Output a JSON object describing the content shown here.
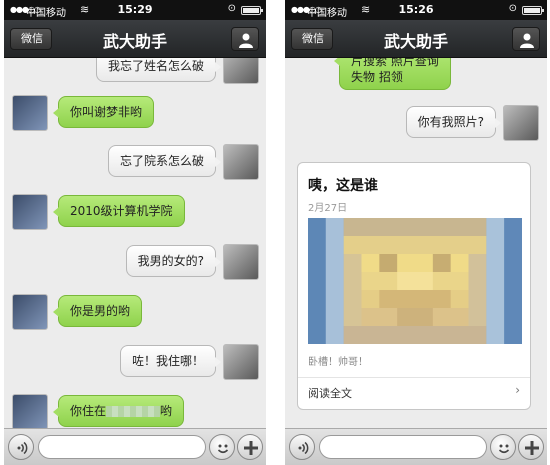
{
  "screens": [
    {
      "status": {
        "carrier": "中国移动",
        "time": "15:29"
      },
      "nav": {
        "back": "微信",
        "title": "武大助手"
      },
      "messages": [
        {
          "from": "me",
          "text": "我忘了姓名怎么破"
        },
        {
          "from": "bot",
          "text": "你叫谢梦非哟"
        },
        {
          "from": "me",
          "text": "忘了院系怎么破"
        },
        {
          "from": "bot",
          "text": "2010级计算机学院"
        },
        {
          "from": "me",
          "text": "我男的女的?"
        },
        {
          "from": "bot",
          "text": "你是男的哟"
        },
        {
          "from": "me",
          "text": "咗！我住哪！"
        },
        {
          "from": "bot",
          "text_before": "你住在",
          "text_after": "哟"
        }
      ]
    },
    {
      "status": {
        "carrier": "中国移动",
        "time": "15:26"
      },
      "nav": {
        "back": "微信",
        "title": "武大助手"
      },
      "partial_bot_line1": "片搜索  照片查询",
      "partial_bot_line2": "失物  招领",
      "me_message": "你有我照片?",
      "card": {
        "title": "咦，这是谁",
        "date": "2月27日",
        "summary": "卧槽！帅哥！",
        "read_more": "阅读全文"
      }
    }
  ],
  "icons": {
    "profile": "person-icon",
    "voice": "voice-icon",
    "emoji": "emoji-icon",
    "plus": "plus-icon",
    "chevron": "chevron-right-icon"
  },
  "colors": {
    "bubble_green": "#9ad95a",
    "bubble_white": "#f4f4f4",
    "navbar": "#2e3033",
    "chat_bg": "#ececec"
  }
}
